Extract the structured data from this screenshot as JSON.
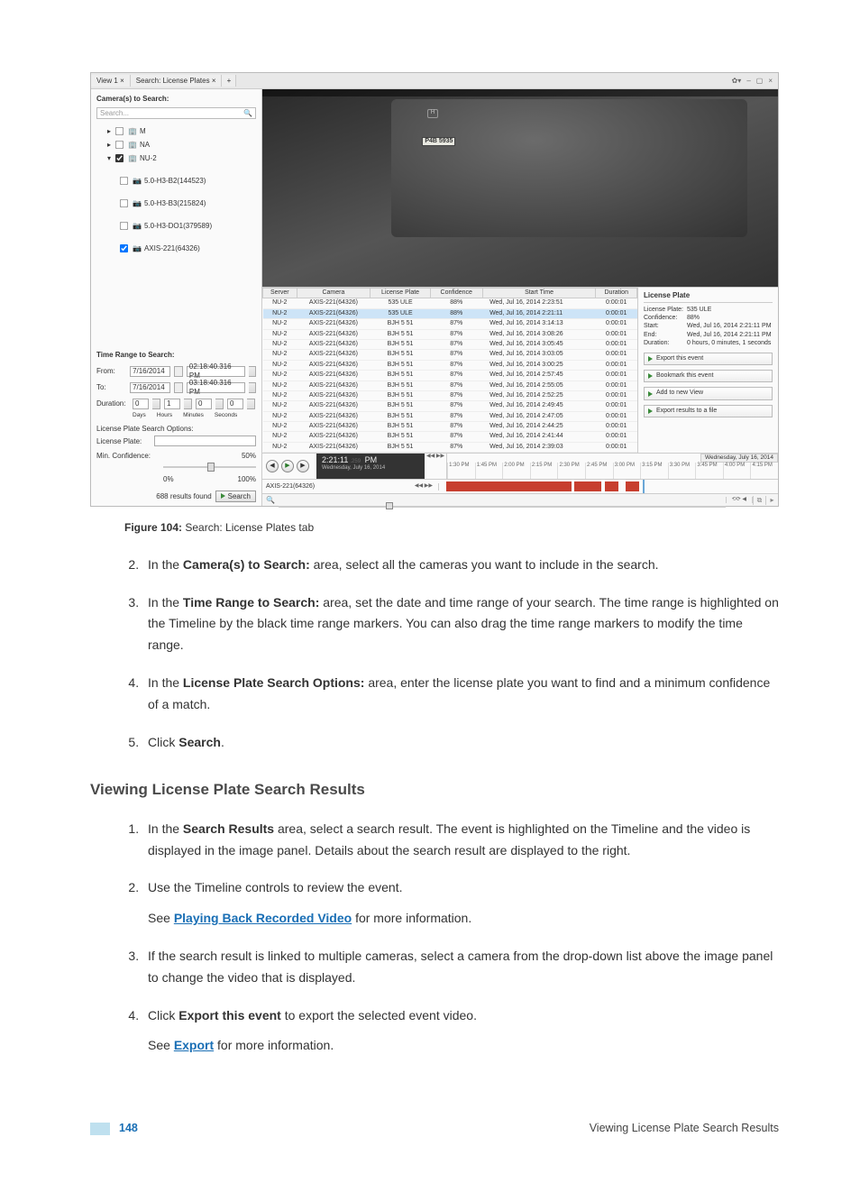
{
  "app": {
    "tabs": {
      "view1": "View 1 ×",
      "search": "Search: License Plates ×",
      "add": "+"
    },
    "winbtns": {
      "gear": "✿▾",
      "min": "–",
      "max": "▢",
      "close": "×"
    }
  },
  "left": {
    "cameras_hdr": "Camera(s) to Search:",
    "search_placeholder": "Search...",
    "tree": {
      "m": "M",
      "na": "NA",
      "nu2": "NU-2",
      "c1": "5.0-H3-B2(144523)",
      "c2": "5.0-H3-B3(215824)",
      "c3": "5.0-H3-DO1(379589)",
      "c4": "AXIS-221(64326)"
    },
    "timerange_hdr": "Time Range to Search:",
    "from_lbl": "From:",
    "to_lbl": "To:",
    "dur_lbl": "Duration:",
    "from_date": "7/16/2014",
    "from_time": "02:18:40.316 PM",
    "to_date": "7/16/2014",
    "to_time": "03:18:40.316 PM",
    "d_days": "0",
    "d_hours": "1",
    "d_min": "0",
    "d_sec": "0",
    "durlabels": {
      "d": "Days",
      "h": "Hours",
      "m": "Minutes",
      "s": "Seconds"
    },
    "lp_opts_hdr": "License Plate Search Options:",
    "lp_lbl": "License Plate:",
    "conf_lbl": "Min. Confidence:",
    "conf_val": "50%",
    "conf_lo": "0%",
    "conf_hi": "100%",
    "results_found": "688 results found",
    "search_btn": "Search"
  },
  "video": {
    "plate": "P4B 5935",
    "logo": "H"
  },
  "grid": {
    "cols": {
      "server": "Server",
      "camera": "Camera",
      "plate": "License Plate",
      "conf": "Confidence",
      "start": "Start Time",
      "dur": "Duration"
    },
    "rows": [
      {
        "server": "NU-2",
        "camera": "AXIS-221(64326)",
        "plate": "535 ULE",
        "conf": "88%",
        "start": "Wed, Jul 16, 2014 2:23:51",
        "dur": "0:00:01"
      },
      {
        "server": "NU-2",
        "camera": "AXIS-221(64326)",
        "plate": "535 ULE",
        "conf": "88%",
        "start": "Wed, Jul 16, 2014 2:21:11",
        "dur": "0:00:01",
        "sel": true
      },
      {
        "server": "NU-2",
        "camera": "AXIS-221(64326)",
        "plate": "BJH 5 51",
        "conf": "87%",
        "start": "Wed, Jul 16, 2014 3:14:13",
        "dur": "0:00:01"
      },
      {
        "server": "NU-2",
        "camera": "AXIS-221(64326)",
        "plate": "BJH 5 51",
        "conf": "87%",
        "start": "Wed, Jul 16, 2014 3:08:26",
        "dur": "0:00:01"
      },
      {
        "server": "NU-2",
        "camera": "AXIS-221(64326)",
        "plate": "BJH 5 51",
        "conf": "87%",
        "start": "Wed, Jul 16, 2014 3:05:45",
        "dur": "0:00:01"
      },
      {
        "server": "NU-2",
        "camera": "AXIS-221(64326)",
        "plate": "BJH 5 51",
        "conf": "87%",
        "start": "Wed, Jul 16, 2014 3:03:05",
        "dur": "0:00:01"
      },
      {
        "server": "NU-2",
        "camera": "AXIS-221(64326)",
        "plate": "BJH 5 51",
        "conf": "87%",
        "start": "Wed, Jul 16, 2014 3:00:25",
        "dur": "0:00:01"
      },
      {
        "server": "NU-2",
        "camera": "AXIS-221(64326)",
        "plate": "BJH 5 51",
        "conf": "87%",
        "start": "Wed, Jul 16, 2014 2:57:45",
        "dur": "0:00:01"
      },
      {
        "server": "NU-2",
        "camera": "AXIS-221(64326)",
        "plate": "BJH 5 51",
        "conf": "87%",
        "start": "Wed, Jul 16, 2014 2:55:05",
        "dur": "0:00:01"
      },
      {
        "server": "NU-2",
        "camera": "AXIS-221(64326)",
        "plate": "BJH 5 51",
        "conf": "87%",
        "start": "Wed, Jul 16, 2014 2:52:25",
        "dur": "0:00:01"
      },
      {
        "server": "NU-2",
        "camera": "AXIS-221(64326)",
        "plate": "BJH 5 51",
        "conf": "87%",
        "start": "Wed, Jul 16, 2014 2:49:45",
        "dur": "0:00:01"
      },
      {
        "server": "NU-2",
        "camera": "AXIS-221(64326)",
        "plate": "BJH 5 51",
        "conf": "87%",
        "start": "Wed, Jul 16, 2014 2:47:05",
        "dur": "0:00:01"
      },
      {
        "server": "NU-2",
        "camera": "AXIS-221(64326)",
        "plate": "BJH 5 51",
        "conf": "87%",
        "start": "Wed, Jul 16, 2014 2:44:25",
        "dur": "0:00:01"
      },
      {
        "server": "NU-2",
        "camera": "AXIS-221(64326)",
        "plate": "BJH 5 51",
        "conf": "87%",
        "start": "Wed, Jul 16, 2014 2:41:44",
        "dur": "0:00:01"
      },
      {
        "server": "NU-2",
        "camera": "AXIS-221(64326)",
        "plate": "BJH 5 51",
        "conf": "87%",
        "start": "Wed, Jul 16, 2014 2:39:03",
        "dur": "0:00:01"
      }
    ]
  },
  "detail": {
    "title": "License Plate",
    "plate_k": "License Plate:",
    "plate_v": "535 ULE",
    "conf_k": "Confidence:",
    "conf_v": "88%",
    "start_k": "Start:",
    "start_v": "Wed, Jul 16, 2014 2:21:11 PM",
    "end_k": "End:",
    "end_v": "Wed, Jul 16, 2014 2:21:11 PM",
    "dur_k": "Duration:",
    "dur_v": "0 hours, 0 minutes, 1 seconds",
    "b1": "Export this event",
    "b2": "Bookmark this event",
    "b3": "Add to new View",
    "b4": "Export results to a file"
  },
  "timeline": {
    "now_time": "2:21:11",
    "now_ms": ".259",
    "now_ampm": " PM",
    "now_date": "Wednesday, July 16, 2014",
    "date_hdr": "Wednesday, July 16, 2014",
    "ticks": [
      "1:30 PM",
      "1:45 PM",
      "2:00 PM",
      "2:15 PM",
      "2:30 PM",
      "2:45 PM",
      "3:00 PM",
      "3:15 PM",
      "3:30 PM",
      "3:45 PM",
      "4:00 PM",
      "4:15 PM"
    ],
    "cam": "AXIS-221(64326)"
  },
  "doc": {
    "caption_lead": "Figure 104: ",
    "caption_tail": "Search: License Plates tab",
    "s2a": "In the ",
    "s2b": "Camera(s) to Search:",
    "s2c": " area, select all the cameras you want to include in the search.",
    "s3a": "In the ",
    "s3b": "Time Range to Search:",
    "s3c": " area, set the date and time range of your search. The time range is highlighted on the Timeline by the black time range markers. You can also drag the time range markers to modify the time range.",
    "s4a": "In the ",
    "s4b": "License Plate Search Options:",
    "s4c": " area, enter the license plate you want to find and a minimum confidence of a match.",
    "s5a": "Click ",
    "s5b": "Search",
    "s5c": ".",
    "h2": "Viewing License Plate Search Results",
    "r1a": "In the ",
    "r1b": "Search Results",
    "r1c": " area, select a search result. The event is highlighted on the Timeline and the video is displayed in the image panel. Details about the search result are displayed to the right.",
    "r2": "Use the Timeline controls to review the event.",
    "r2s_a": "See ",
    "r2s_link": "Playing Back Recorded Video",
    "r2s_b": " for more information.",
    "r3": "If the search result is linked to multiple cameras, select a camera from the drop-down list above the image panel to change the video that is displayed.",
    "r4a": "Click ",
    "r4b": "Export this event",
    "r4c": " to export the selected event video.",
    "r4s_a": "See ",
    "r4s_link": "Export",
    "r4s_b": " for more information.",
    "pnum": "148",
    "ftitle": "Viewing License Plate Search Results"
  }
}
